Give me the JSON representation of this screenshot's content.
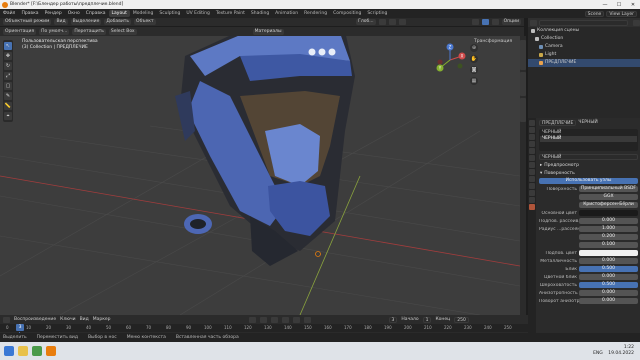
{
  "window": {
    "title": "Blender* [F:\\Блендер работы\\предплечие.blend]",
    "controls": [
      "—",
      "☐",
      "✕"
    ]
  },
  "menubar": {
    "menus": [
      "Файл",
      "Правка",
      "Рендер",
      "Окно",
      "Справка"
    ],
    "workspaces": [
      "Layout",
      "Modeling",
      "Sculpting",
      "UV Editing",
      "Texture Paint",
      "Shading",
      "Animation",
      "Rendering",
      "Compositing",
      "Scripting"
    ],
    "active_workspace": "Layout",
    "scene_label": "Scene",
    "view_layer_label": "View Layer"
  },
  "tool_header": {
    "mode": "Объектный режим",
    "items": [
      "Вид",
      "Выделение",
      "Добавить",
      "Объект"
    ],
    "orientation": "Глоб...",
    "options": "Опции"
  },
  "view_header": {
    "mode": "Ориентация",
    "default": "По умолч...",
    "drag": "Перетащить",
    "select": "Select Box",
    "material": "Материалы"
  },
  "viewport": {
    "info_line1": "Пользовательская перспектива",
    "info_line2": "(3) Collection | ПРЕДПЛЕЧИЕ",
    "transform_label": "Трансформация",
    "gizmo": {
      "x": "X",
      "y": "Y",
      "z": "Z"
    },
    "tools": [
      "↖",
      "✥",
      "↻",
      "⤢",
      "▢",
      "✎",
      "📏",
      "⌖"
    ]
  },
  "outliner": {
    "header": "Коллекция сцены",
    "rows": [
      {
        "label": "Коллекция сцены",
        "color": "#bfbfbf"
      },
      {
        "label": "Collection",
        "color": "#bfbfbf"
      },
      {
        "label": "Camera",
        "color": "#6e8fb5"
      },
      {
        "label": "Light",
        "color": "#c9a84a"
      },
      {
        "label": "ПРЕДПЛЕЧИЕ",
        "color": "#e8a24d"
      }
    ]
  },
  "properties": {
    "object_name": "ПРЕДПЛЕЧИЕ",
    "material_slot": "ЧЕРНЫЙ",
    "material_name": "ЧЕРНЫЙ",
    "sections": [
      "Предпросмотр",
      "Поверхность"
    ],
    "use_nodes": "Использовать узлы",
    "surface_label": "Поверхность",
    "surface_value": "Принципиальный BSDF",
    "distribution": "GGX",
    "subsurface_method": "Кристоферсен-Бёрли",
    "rows": [
      {
        "label": "Основной цвет",
        "value": "",
        "style": "dark"
      },
      {
        "label": "Подпов. рассеив...",
        "value": "0.000",
        "style": ""
      },
      {
        "label": "Радиус ...рассеяния",
        "value": "1.000",
        "style": ""
      },
      {
        "label": "",
        "value": "0.200",
        "style": ""
      },
      {
        "label": "",
        "value": "0.100",
        "style": ""
      },
      {
        "label": "Подпов. цвет",
        "value": "",
        "style": "white"
      },
      {
        "label": "Металличность",
        "value": "0.000",
        "style": ""
      },
      {
        "label": "Блик",
        "value": "0.500",
        "style": "blue"
      },
      {
        "label": "Цветной блик",
        "value": "0.000",
        "style": ""
      },
      {
        "label": "Шероховатость",
        "value": "0.500",
        "style": "blue"
      },
      {
        "label": "Анизотропность",
        "value": "0.000",
        "style": ""
      },
      {
        "label": "Поворот анизотр...",
        "value": "0.000",
        "style": ""
      }
    ]
  },
  "timeline": {
    "items": [
      "Воспроизведение",
      "Ключи",
      "Вид",
      "Маркер"
    ],
    "current_frame": "3",
    "start_label": "Начало",
    "start": "1",
    "end_label": "Конец",
    "end": "250",
    "ticks": [
      "0",
      "10",
      "20",
      "30",
      "40",
      "50",
      "60",
      "70",
      "80",
      "90",
      "100",
      "110",
      "120",
      "130",
      "140",
      "150",
      "160",
      "170",
      "180",
      "190",
      "200",
      "210",
      "220",
      "230",
      "240",
      "250"
    ]
  },
  "statusbar": {
    "items": [
      "Выделить",
      "Переместить вид",
      "Выбор в нос",
      "Меню контекста",
      "Вставленная часть обзора"
    ]
  },
  "taskbar": {
    "time": "1:22",
    "date": "19.04.2022",
    "lang": "ENG"
  },
  "colors": {
    "accent": "#4772b3",
    "helmet": "#5d79c4",
    "orange": "#e87d0d"
  }
}
